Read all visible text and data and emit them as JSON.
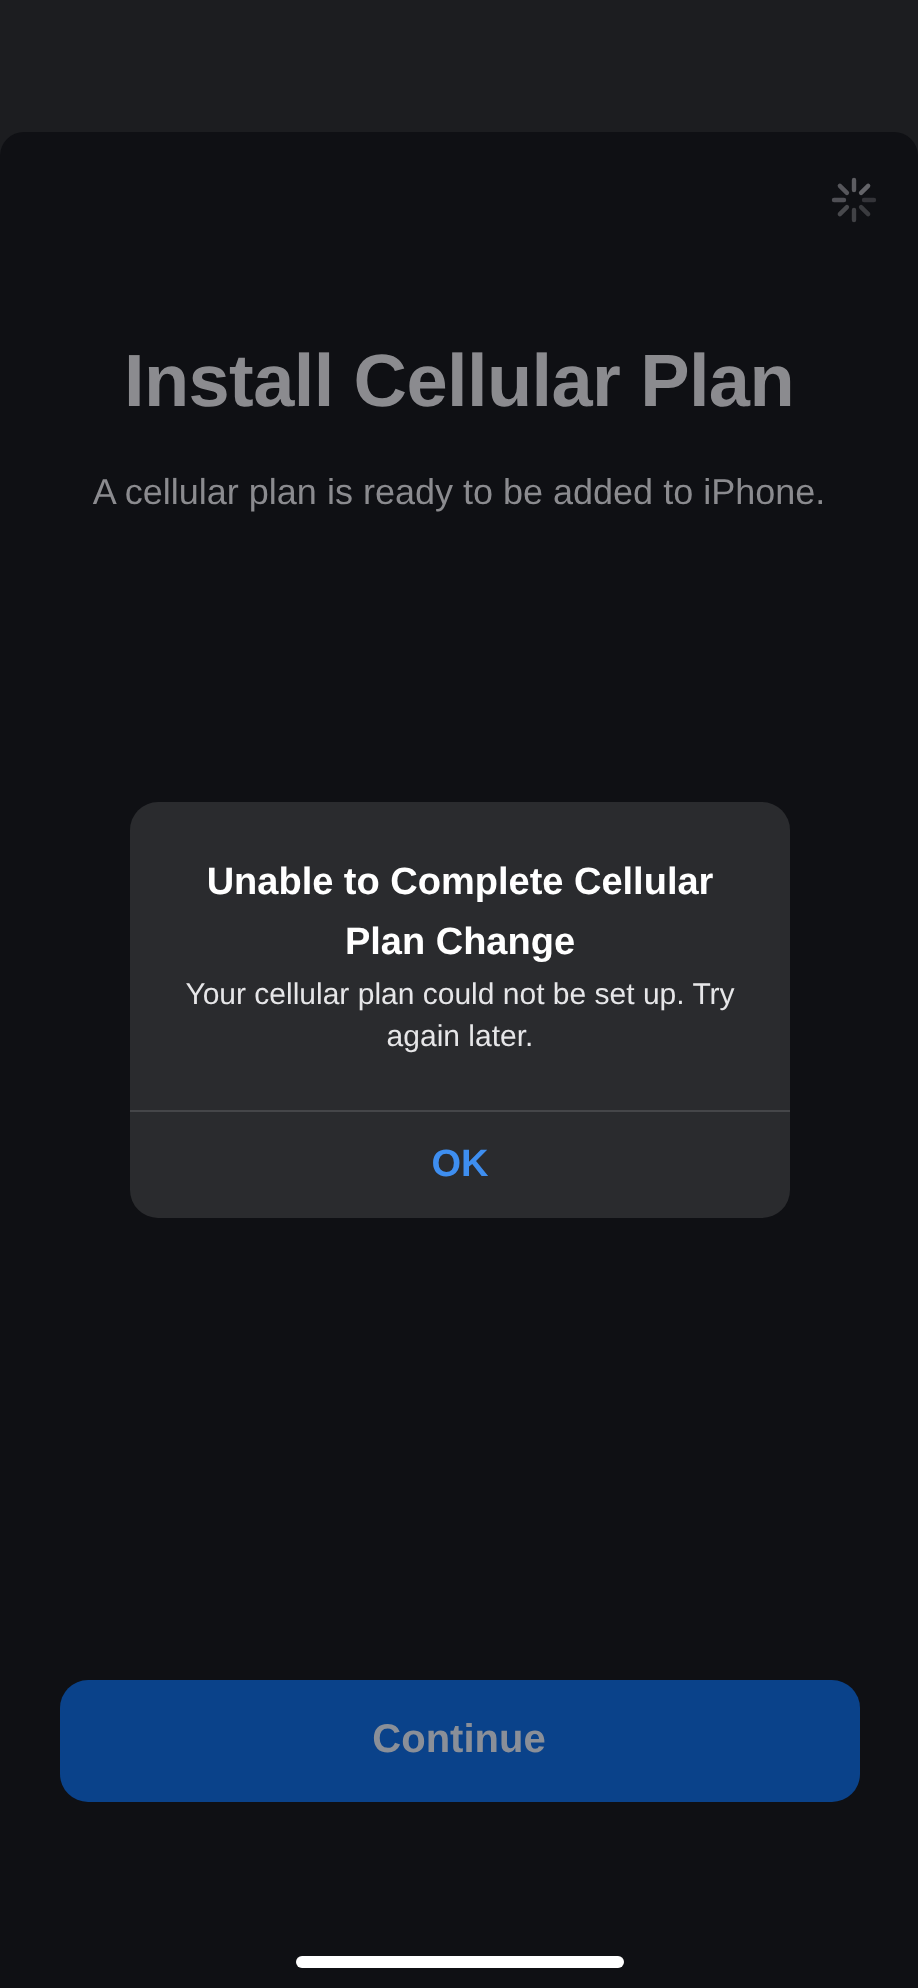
{
  "screen": {
    "title": "Install Cellular Plan",
    "subtitle": "A cellular plan is ready to be added to iPhone.",
    "loading": true
  },
  "alert": {
    "title": "Unable to Complete Cellular Plan Change",
    "message": "Your cellular plan could not be set up. Try again later.",
    "buttons": [
      "OK"
    ]
  },
  "primary_button": {
    "label": "Continue",
    "disabled": true
  }
}
